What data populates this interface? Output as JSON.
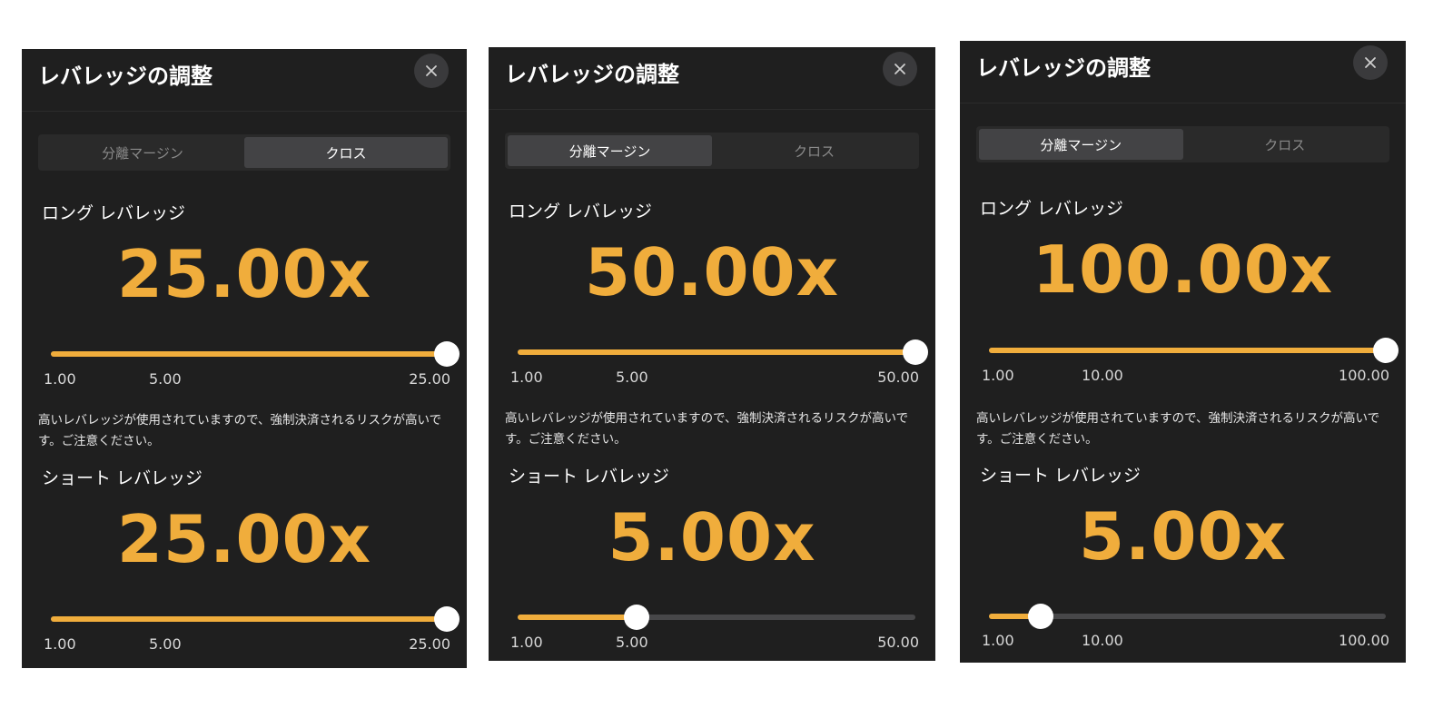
{
  "colors": {
    "panel_bg": "#1f1f1f",
    "accent": "#f0ad3c",
    "track": "#474749"
  },
  "panels": [
    {
      "title": "レバレッジの調整",
      "close_icon": "close-icon",
      "tabs": [
        {
          "label": "分離マージン",
          "active": false
        },
        {
          "label": "クロス",
          "active": true
        }
      ],
      "long": {
        "label": "ロング レバレッジ",
        "value": "25.00x",
        "slider_fraction": 1.0,
        "ticks": {
          "min": "1.00",
          "mid": "5.00",
          "max": "25.00"
        }
      },
      "warning": "高いレバレッジが使用されていますので、強制決済されるリスクが高いです。ご注意ください。",
      "short": {
        "label": "ショート レバレッジ",
        "value": "25.00x",
        "slider_fraction": 1.0,
        "ticks": {
          "min": "1.00",
          "mid": "5.00",
          "max": "25.00"
        }
      }
    },
    {
      "title": "レバレッジの調整",
      "close_icon": "close-icon",
      "tabs": [
        {
          "label": "分離マージン",
          "active": true
        },
        {
          "label": "クロス",
          "active": false
        }
      ],
      "long": {
        "label": "ロング レバレッジ",
        "value": "50.00x",
        "slider_fraction": 1.0,
        "ticks": {
          "min": "1.00",
          "mid": "5.00",
          "max": "50.00"
        }
      },
      "warning": "高いレバレッジが使用されていますので、強制決済されるリスクが高いです。ご注意ください。",
      "short": {
        "label": "ショート レバレッジ",
        "value": "5.00x",
        "slider_fraction": 0.3,
        "ticks": {
          "min": "1.00",
          "mid": "5.00",
          "max": "50.00"
        }
      }
    },
    {
      "title": "レバレッジの調整",
      "close_icon": "close-icon",
      "tabs": [
        {
          "label": "分離マージン",
          "active": true
        },
        {
          "label": "クロス",
          "active": false
        }
      ],
      "long": {
        "label": "ロング レバレッジ",
        "value": "100.00x",
        "slider_fraction": 1.0,
        "ticks": {
          "min": "1.00",
          "mid": "10.00",
          "max": "100.00"
        }
      },
      "warning": "高いレバレッジが使用されていますので、強制決済されるリスクが高いです。ご注意ください。",
      "short": {
        "label": "ショート レバレッジ",
        "value": "5.00x",
        "slider_fraction": 0.13,
        "ticks": {
          "min": "1.00",
          "mid": "10.00",
          "max": "100.00"
        }
      }
    }
  ]
}
